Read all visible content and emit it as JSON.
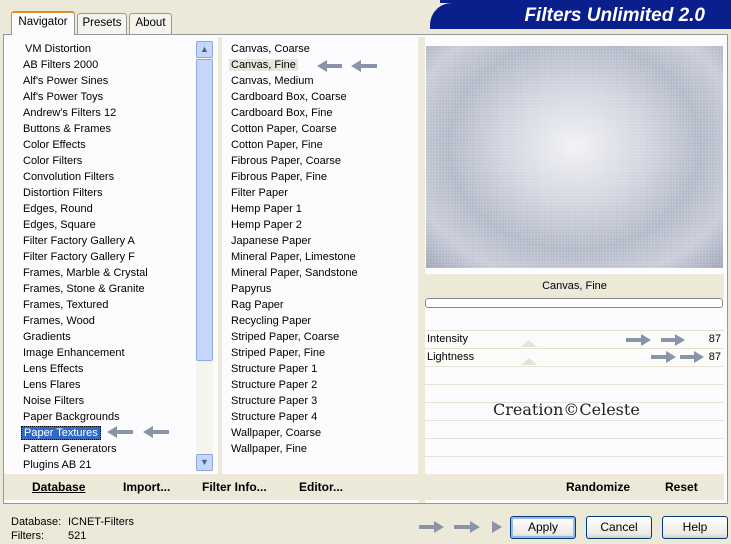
{
  "window": {
    "banner_title": "Filters Unlimited 2.0"
  },
  "tabs": [
    {
      "label": "Navigator",
      "active": true
    },
    {
      "label": "Presets",
      "active": false
    },
    {
      "label": "About",
      "active": false
    }
  ],
  "categories": [
    "VM Distortion",
    "AB Filters 2000",
    "Alf's Power Sines",
    "Alf's Power Toys",
    "Andrew's Filters 12",
    "Buttons & Frames",
    "Color Effects",
    "Color Filters",
    "Convolution Filters",
    "Distortion Filters",
    "Edges, Round",
    "Edges, Square",
    "Filter Factory Gallery A",
    "Filter Factory Gallery F",
    "Frames, Marble & Crystal",
    "Frames, Stone & Granite",
    "Frames, Textured",
    "Frames, Wood",
    "Gradients",
    "Image Enhancement",
    "Lens Effects",
    "Lens Flares",
    "Noise Filters",
    "Paper Backgrounds",
    "Paper Textures",
    "Pattern Generators",
    "Plugins AB 21"
  ],
  "selected_category": "Paper Textures",
  "filters": [
    "Canvas, Coarse",
    "Canvas, Fine",
    "Canvas, Medium",
    "Cardboard Box, Coarse",
    "Cardboard Box, Fine",
    "Cotton Paper, Coarse",
    "Cotton Paper, Fine",
    "Fibrous Paper, Coarse",
    "Fibrous Paper, Fine",
    "Filter Paper",
    "Hemp Paper 1",
    "Hemp Paper 2",
    "Japanese Paper",
    "Mineral Paper, Limestone",
    "Mineral Paper, Sandstone",
    "Papyrus",
    "Rag Paper",
    "Recycling Paper",
    "Striped Paper, Coarse",
    "Striped Paper, Fine",
    "Structure Paper 1",
    "Structure Paper 2",
    "Structure Paper 3",
    "Structure Paper 4",
    "Wallpaper, Coarse",
    "Wallpaper, Fine"
  ],
  "selected_filter": "Canvas, Fine",
  "preview": {
    "filter_name": "Canvas, Fine",
    "progress": 0
  },
  "params": [
    {
      "label": "Intensity",
      "value": "87"
    },
    {
      "label": "Lightness",
      "value": "87"
    }
  ],
  "credit": "Creation©Celeste",
  "toolbar": {
    "database": "Database",
    "import": "Import...",
    "filter_info": "Filter Info...",
    "editor": "Editor...",
    "randomize": "Randomize",
    "reset": "Reset"
  },
  "status": {
    "database_label": "Database:",
    "database_value": "ICNET-Filters",
    "filters_label": "Filters:",
    "filters_value": "521"
  },
  "buttons": {
    "apply": "Apply",
    "cancel": "Cancel",
    "help": "Help"
  },
  "colors": {
    "banner": "#0a1e8c",
    "selection": "#316ac5",
    "arrow": "#8a94a8"
  }
}
